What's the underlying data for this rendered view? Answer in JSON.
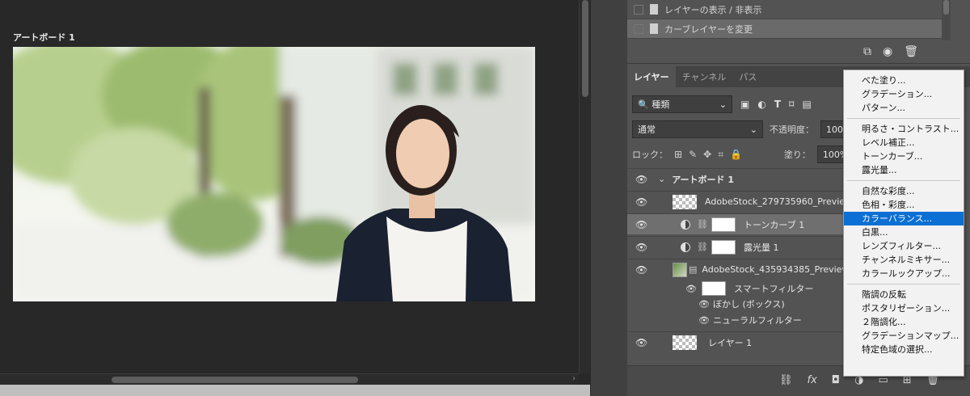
{
  "canvas": {
    "artboard_label": "アートボード 1"
  },
  "history": {
    "items": [
      {
        "label": "レイヤーの表示 / 非表示"
      },
      {
        "label": "カーブレイヤーを変更"
      }
    ]
  },
  "tabs": [
    "レイヤー",
    "チャンネル",
    "パス"
  ],
  "filter": {
    "kind_label": "種類"
  },
  "blend": {
    "mode": "通常",
    "opacity_label": "不透明度：",
    "opacity_value": "100%"
  },
  "lock": {
    "label": "ロック：",
    "fill_label": "塗り：",
    "fill_value": "100%"
  },
  "layers": [
    {
      "name": "アートボード 1"
    },
    {
      "name": "AdobeStock_279735960_Preview"
    },
    {
      "name": "トーンカーブ 1"
    },
    {
      "name": "露光量 1"
    },
    {
      "name": "AdobeStock_435934385_Preview"
    },
    {
      "name": "スマートフィルター"
    },
    {
      "name": "ぼかし (ボックス)"
    },
    {
      "name": "ニューラルフィルター"
    },
    {
      "name": "レイヤー 1"
    }
  ],
  "menu": {
    "group1": [
      "べた塗り...",
      "グラデーション...",
      "パターン..."
    ],
    "group2": [
      "明るさ・コントラスト...",
      "レベル補正...",
      "トーンカーブ...",
      "露光量..."
    ],
    "group3": [
      "自然な彩度...",
      "色相・彩度...",
      "カラーバランス...",
      "白黒...",
      "レンズフィルター...",
      "チャンネルミキサー...",
      "カラールックアップ..."
    ],
    "group4": [
      "階調の反転",
      "ポスタリゼーション...",
      "２階調化...",
      "グラデーションマップ...",
      "特定色域の選択..."
    ],
    "highlighted": "カラーバランス..."
  },
  "colors": {
    "menu_highlight": "#0b6fd3",
    "panel_bg": "#535353",
    "canvas_bg": "#282828"
  }
}
